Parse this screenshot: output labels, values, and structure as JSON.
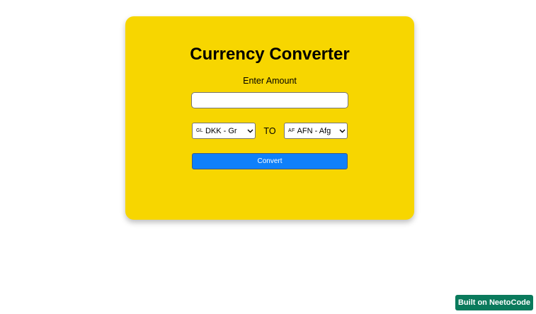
{
  "converter": {
    "title": "Currency Converter",
    "amount_label": "Enter Amount",
    "amount_value": "",
    "from_flag": "GL",
    "from_currency": "DKK - Gr",
    "to_label": "TO",
    "to_flag": "AF",
    "to_currency": "AFN - Afg",
    "convert_label": "Convert"
  },
  "footer": {
    "badge_label": "Built on NeetoCode"
  },
  "colors": {
    "card_background": "#f7d600",
    "button_background": "#0f80fa",
    "badge_background": "#0a7a5c"
  },
  "icons": {
    "select_arrow": "chevron-down-icon"
  }
}
